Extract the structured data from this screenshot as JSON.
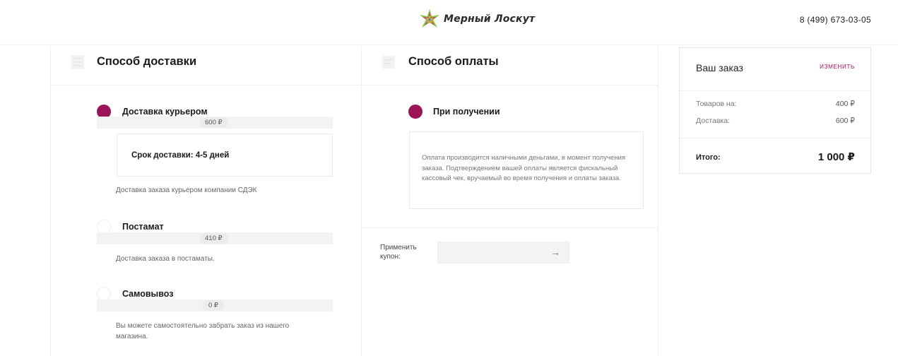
{
  "header": {
    "logo_text": "Мерный Лоскут",
    "phone": "8 (499) 673-03-05"
  },
  "delivery": {
    "title": "Способ доставки",
    "options": [
      {
        "label": "Доставка курьером",
        "price": "600 ₽",
        "selected": true,
        "term": "Срок доставки: 4-5 дней",
        "description": "Доставка заказа курьером компании СДЭК"
      },
      {
        "label": "Постамат",
        "price": "410 ₽",
        "selected": false,
        "description": "Доставка заказа в постаматы."
      },
      {
        "label": "Самовывоз",
        "price": "0 ₽",
        "selected": false,
        "description_line1": "Вы можете самостоятельно забрать заказ из нашего",
        "description_line2": "магазина."
      }
    ]
  },
  "payment": {
    "title": "Способ оплаты",
    "option_label": "При получении",
    "description": "Оплата производится наличными деньгами, в момент получения заказа. Подтверждением вашей оплаты является фискальный кассовый чек, вручаемый во время получения и оплаты заказа.",
    "coupon_label": "Применить купон:",
    "coupon_value": "",
    "coupon_arrow": "→"
  },
  "order": {
    "title": "Ваш заказ",
    "edit_label": "ИЗМЕНИТЬ",
    "goods_label": "Товаров на:",
    "goods_value": "400 ₽",
    "delivery_label": "Доставка:",
    "delivery_value": "600 ₽",
    "total_label": "Итого:",
    "total_value": "1 000 ₽"
  },
  "colors": {
    "accent": "#9b1457",
    "muted_bg": "#f3f3f3"
  }
}
